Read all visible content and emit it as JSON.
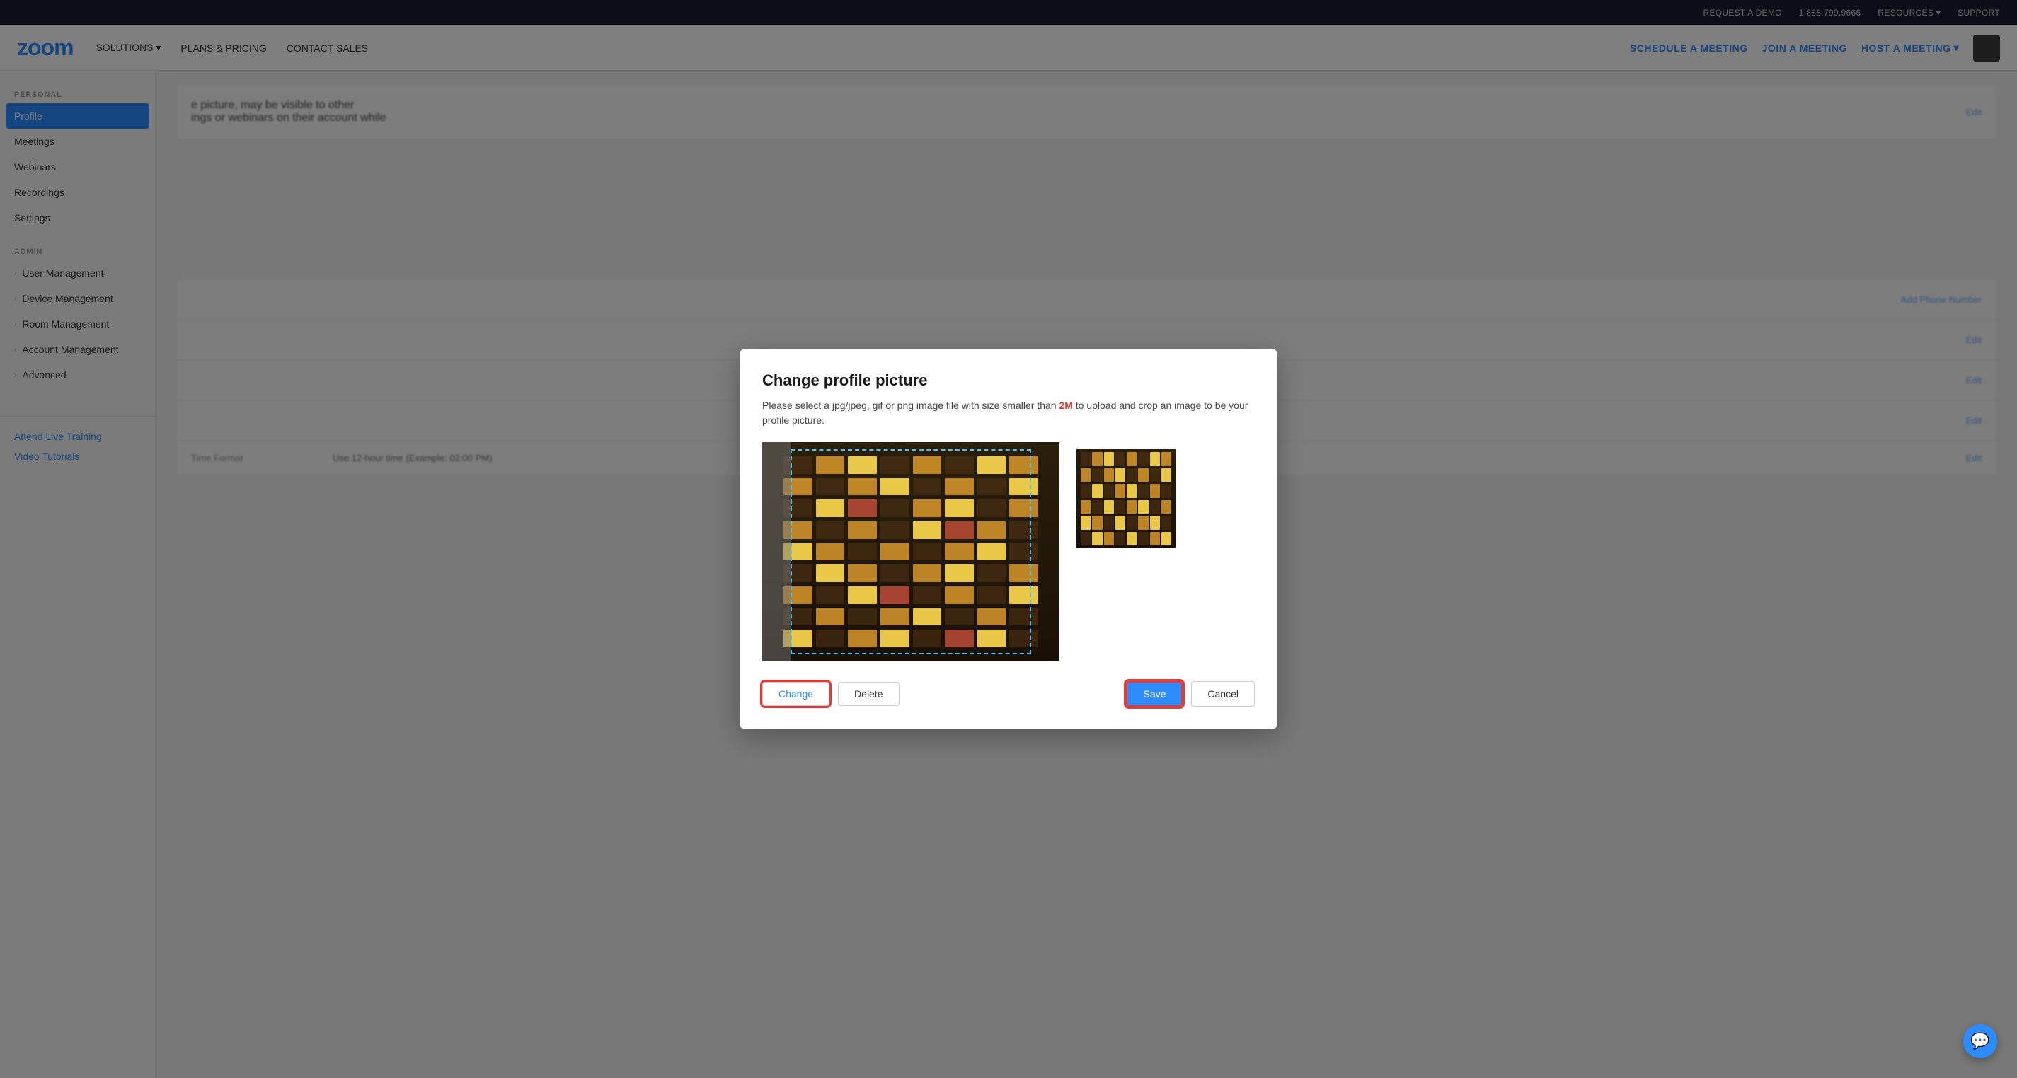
{
  "topbar": {
    "request_demo": "REQUEST A DEMO",
    "phone": "1.888.799.9666",
    "resources": "RESOURCES",
    "support": "SUPPORT"
  },
  "mainnav": {
    "logo": "zoom",
    "solutions": "SOLUTIONS",
    "plans_pricing": "PLANS & PRICING",
    "contact_sales": "CONTACT SALES",
    "schedule": "SCHEDULE A MEETING",
    "join": "JOIN A MEETING",
    "host": "HOST A MEETING"
  },
  "sidebar": {
    "personal_label": "PERSONAL",
    "profile": "Profile",
    "meetings": "Meetings",
    "webinars": "Webinars",
    "recordings": "Recordings",
    "settings": "Settings",
    "admin_label": "ADMIN",
    "user_management": "User Management",
    "device_management": "Device Management",
    "room_management": "Room Management",
    "account_management": "Account Management",
    "advanced": "Advanced",
    "attend_live_training": "Attend Live Training",
    "video_tutorials": "Video Tutorials"
  },
  "modal": {
    "title": "Change profile picture",
    "description_part1": "Please select a jpg/jpeg, gif or png image file with size smaller than ",
    "size_limit": "2M",
    "description_part2": " to upload and crop an image to be your profile picture.",
    "change_btn": "Change",
    "delete_btn": "Delete",
    "save_btn": "Save",
    "cancel_btn": "Cancel"
  },
  "main_content": {
    "description_text": "e picture, may be visible to other",
    "description_text2": "ings or webinars on their account while",
    "edit_labels": [
      "Edit",
      "Edit",
      "Edit",
      "Edit",
      "Edit"
    ],
    "add_phone": "Add Phone Number",
    "time_format_label": "Time Format",
    "time_format_value": "Use 12-hour time (Example: 02:00 PM)"
  },
  "chat": {
    "icon": "💬"
  }
}
